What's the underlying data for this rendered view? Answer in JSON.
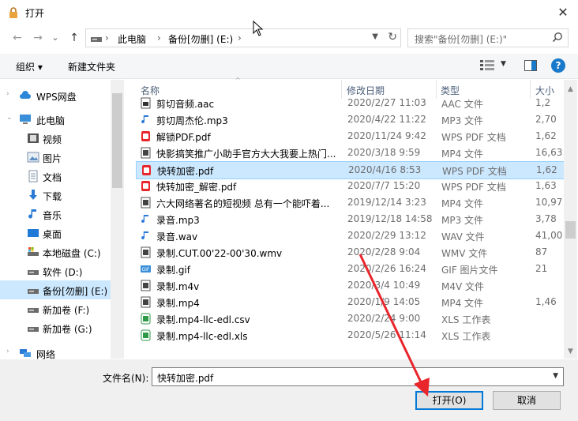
{
  "window": {
    "title": "打开",
    "close_glyph": "✕"
  },
  "nav": {
    "back_glyph": "←",
    "forward_glyph": "→",
    "recent_glyph": "⌄",
    "up_glyph": "↑",
    "breadcrumb": [
      "此电脑",
      "备份[勿删] (E:)"
    ],
    "separator": "›",
    "search_placeholder": "搜索\"备份[勿删] (E:)\""
  },
  "toolbar": {
    "organize": "组织 ▾",
    "new_folder": "新建文件夹"
  },
  "sidebar": {
    "items": [
      {
        "label": "WPS网盘",
        "icon": "cloud-icon",
        "level": 0
      },
      {
        "label": "此电脑",
        "icon": "computer-icon",
        "level": 0
      },
      {
        "label": "视频",
        "icon": "video-folder-icon",
        "level": 1
      },
      {
        "label": "图片",
        "icon": "pictures-folder-icon",
        "level": 1
      },
      {
        "label": "文档",
        "icon": "documents-folder-icon",
        "level": 1
      },
      {
        "label": "下载",
        "icon": "download-icon",
        "level": 1
      },
      {
        "label": "音乐",
        "icon": "music-icon",
        "level": 1
      },
      {
        "label": "桌面",
        "icon": "desktop-icon",
        "level": 1
      },
      {
        "label": "本地磁盘 (C:)",
        "icon": "system-drive-icon",
        "level": 1
      },
      {
        "label": "软件 (D:)",
        "icon": "drive-icon",
        "level": 1
      },
      {
        "label": "备份[勿删] (E:)",
        "icon": "drive-icon",
        "level": 1,
        "selected": true
      },
      {
        "label": "新加卷 (F:)",
        "icon": "drive-icon",
        "level": 1
      },
      {
        "label": "新加卷 (G:)",
        "icon": "drive-icon",
        "level": 1
      },
      {
        "label": "网络",
        "icon": "network-icon",
        "level": 0
      }
    ]
  },
  "columns": {
    "name": "名称",
    "date": "修改日期",
    "type": "类型",
    "size": "大小"
  },
  "files": [
    {
      "name": "剪切音频.aac",
      "date": "2020/2/27 11:03",
      "type": "AAC 文件",
      "size": "1,2",
      "icon": "audio-file-icon"
    },
    {
      "name": "剪切周杰伦.mp3",
      "date": "2020/4/22 11:22",
      "type": "MP3 文件",
      "size": "2,70",
      "icon": "music-file-icon"
    },
    {
      "name": "解锁PDF.pdf",
      "date": "2020/11/24 9:42",
      "type": "WPS PDF 文档",
      "size": "1,62",
      "icon": "pdf-file-icon"
    },
    {
      "name": "快影搞笑推广小助手官方大大我要上热门...",
      "date": "2020/3/18 9:59",
      "type": "MP4 文件",
      "size": "16,63",
      "icon": "video-file-icon"
    },
    {
      "name": "快转加密.pdf",
      "date": "2020/4/16 8:53",
      "type": "WPS PDF 文档",
      "size": "1,62",
      "icon": "pdf-file-icon",
      "selected": true
    },
    {
      "name": "快转加密_解密.pdf",
      "date": "2020/7/7 15:20",
      "type": "WPS PDF 文档",
      "size": "1,63",
      "icon": "pdf-file-icon"
    },
    {
      "name": "六大网络著名的短视频 总有一个能吓着...",
      "date": "2019/12/14 3:23",
      "type": "MP4 文件",
      "size": "10,97",
      "icon": "video-file-icon"
    },
    {
      "name": "录音.mp3",
      "date": "2019/12/18 14:58",
      "type": "MP3 文件",
      "size": "3,78",
      "icon": "music-file-icon"
    },
    {
      "name": "录音.wav",
      "date": "2020/2/29 13:12",
      "type": "WAV 文件",
      "size": "41,00",
      "icon": "music-file-icon"
    },
    {
      "name": "录制.CUT.00'22-00'30.wmv",
      "date": "2020/2/28 9:04",
      "type": "WMV 文件",
      "size": "87",
      "icon": "video-file-icon"
    },
    {
      "name": "录制.gif",
      "date": "2020/2/26 16:24",
      "type": "GIF 图片文件",
      "size": "21",
      "icon": "gif-file-icon"
    },
    {
      "name": "录制.m4v",
      "date": "2020/3/4 10:49",
      "type": "M4V 文件",
      "size": "",
      "icon": "video-file-icon"
    },
    {
      "name": "录制.mp4",
      "date": "2020/1/9 14:05",
      "type": "MP4 文件",
      "size": "1,46",
      "icon": "video-file-icon"
    },
    {
      "name": "录制.mp4-llc-edl.csv",
      "date": "2020/2/24 9:00",
      "type": "XLS 工作表",
      "size": "",
      "icon": "spreadsheet-file-icon"
    },
    {
      "name": "录制.mp4-llc-edl.xls",
      "date": "2020/5/26 11:14",
      "type": "XLS 工作表",
      "size": "",
      "icon": "spreadsheet-file-icon"
    }
  ],
  "bottom": {
    "filename_label": "文件名(N):",
    "filename_value": "快转加密.pdf",
    "open_label": "打开(O)",
    "cancel_label": "取消"
  },
  "colors": {
    "accent": "#0078d7",
    "selection": "#cce8ff",
    "arrow": "#e8262c"
  }
}
